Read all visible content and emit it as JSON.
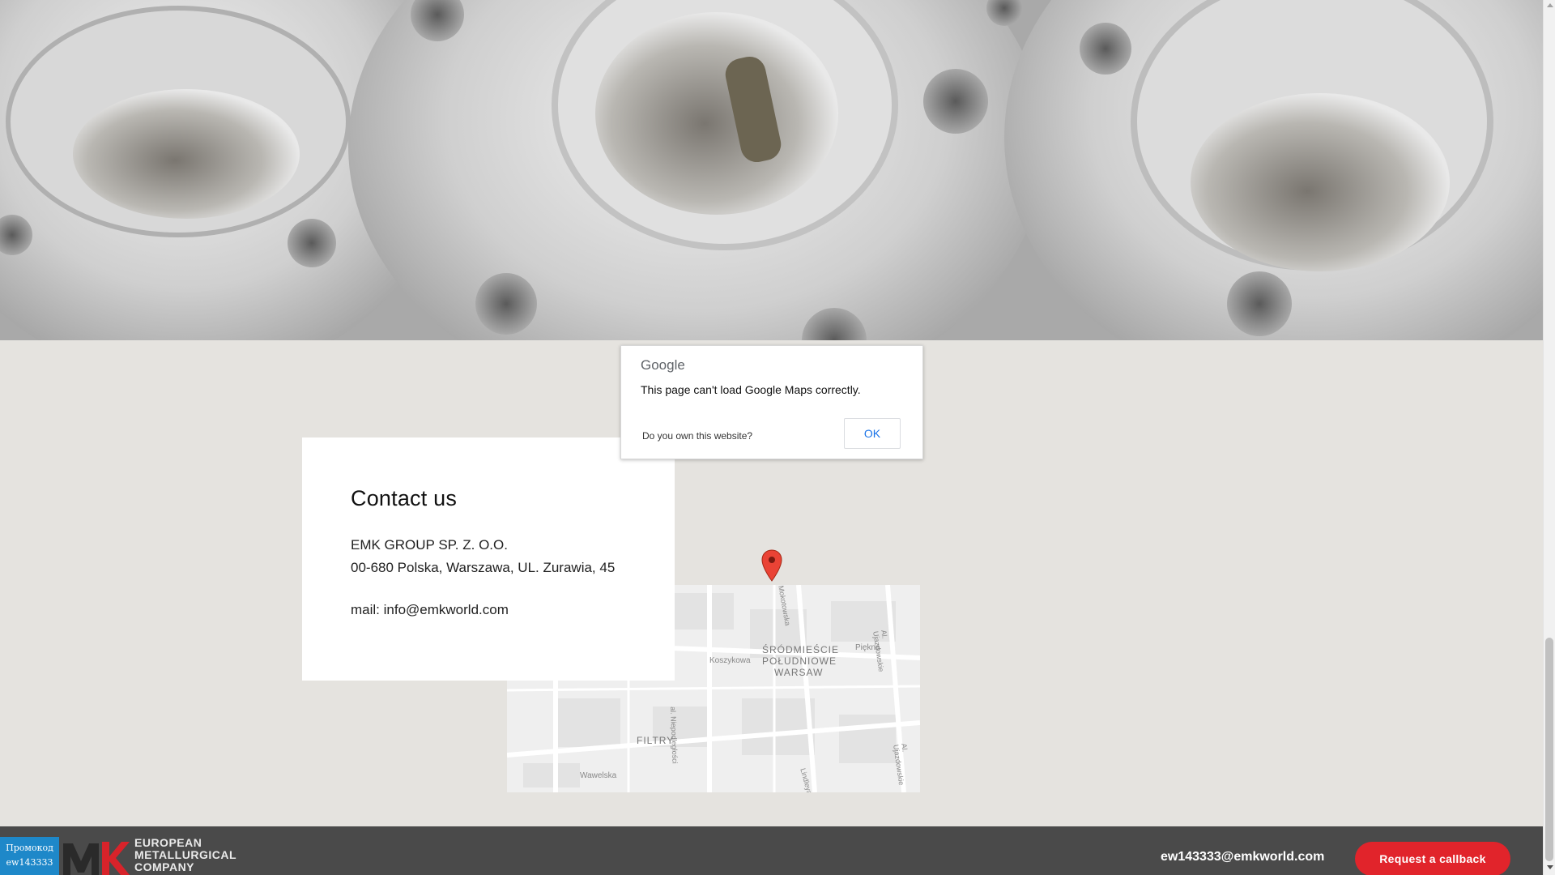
{
  "contact": {
    "title": "Contact us",
    "company": "EMK GROUP SP. Z. O.O.",
    "address": "00-680 Polska, Warszawa, UL. Zurawia, 45",
    "mail": "mail: info@emkworld.com"
  },
  "map_error": {
    "brand": "Google",
    "message": "This page can't load Google Maps correctly.",
    "own_question": "Do you own this website?",
    "ok_label": "OK"
  },
  "map_labels": {
    "district_1": "ŚRÓDMIEŚCIE",
    "district_2": "POŁUDNIOWE",
    "district_3": "WARSAW",
    "filtry": "FILTRY",
    "koszykowa": "Koszykowa",
    "piekna": "Piękna",
    "niepodleglosci": "al. Niepodległości",
    "ujazdowskie_1": "Al. Ujazdowskie",
    "ujazdowskie_2": "Al. Ujazdowskie",
    "mokotowska": "Mokotowska",
    "lindleya": "Lindleya",
    "wawelska": "Wawelska"
  },
  "footer": {
    "promo_line1": "Промокод",
    "promo_line2": "ew143333",
    "logo_line1": "EUROPEAN",
    "logo_line2": "METALLURGICAL",
    "logo_line3": "COMPANY",
    "email": "ew143333@emkworld.com",
    "callback_label": "Request a callback"
  },
  "colors": {
    "accent": "#e1242b",
    "footer_bg": "#4a4a4a",
    "promo_bg": "#1e88c9",
    "map_bg": "#e5e3df"
  },
  "icons": {
    "marker": "map-marker-icon",
    "logo": "emk-logo-icon"
  }
}
